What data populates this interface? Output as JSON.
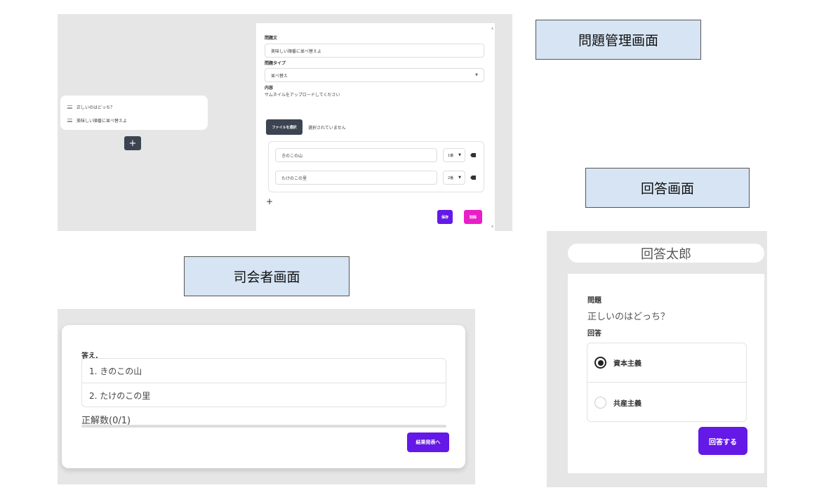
{
  "captions": {
    "admin": "問題管理画面",
    "answer": "回答画面",
    "host": "司会者画面"
  },
  "admin": {
    "question_list": [
      "正しいのはどっち？",
      "美味しい順番に並べ替えよ"
    ],
    "add_button": "+",
    "editor": {
      "question_label": "問題文",
      "question_value": "美味しい順番に並べ替えよ",
      "type_label": "問題タイプ",
      "type_value": "並べ替え",
      "content_label": "内容",
      "thumbnail_text": "サムネイルをアップロードしてください",
      "file_button": "ファイルを選択",
      "file_status": "選択されていません",
      "choices": [
        {
          "text": "きのこの山",
          "order": "1番"
        },
        {
          "text": "たけのこの里",
          "order": "2番"
        }
      ],
      "add_choice": "+",
      "save_button": "保存",
      "delete_button": "削除"
    }
  },
  "host": {
    "answer_label": "答え.",
    "answers": [
      "1. きのこの山",
      "2. たけのこの里"
    ],
    "correct_count": "正解数(0/1)",
    "progress": 0,
    "result_button": "結果発表へ"
  },
  "answerer": {
    "name": "回答太郎",
    "question_label": "問題",
    "question_text": "正しいのはどっち？",
    "answer_label": "回答",
    "options": [
      {
        "label": "資本主義",
        "checked": true
      },
      {
        "label": "共産主義",
        "checked": false
      }
    ],
    "submit_button": "回答する"
  },
  "colors": {
    "primary": "#6419e6",
    "secondary": "#e91ec8",
    "neutral": "#3d4451",
    "caption_bg": "#d6e4f3",
    "panel_bg": "#e6e6e6"
  }
}
